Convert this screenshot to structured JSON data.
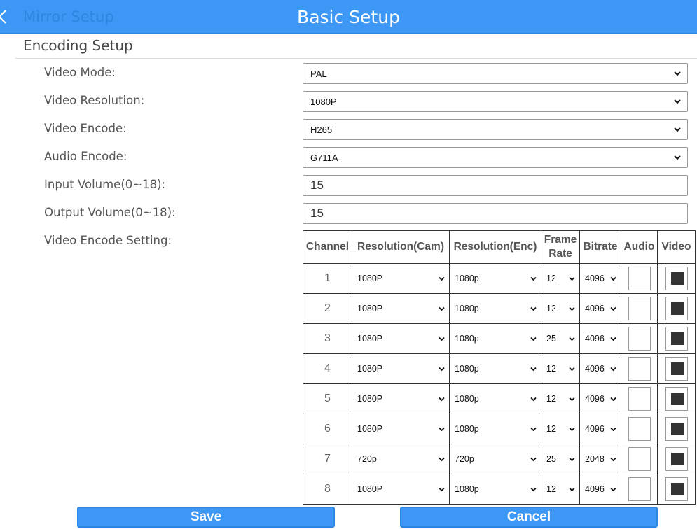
{
  "header": {
    "back_label": "Mirror Setup",
    "title": "Basic Setup"
  },
  "section": {
    "title": "Encoding Setup"
  },
  "form": {
    "video_mode": {
      "label": "Video Mode:",
      "value": "PAL"
    },
    "video_resolution": {
      "label": "Video Resolution:",
      "value": "1080P"
    },
    "video_encode": {
      "label": "Video Encode:",
      "value": "H265"
    },
    "audio_encode": {
      "label": "Audio Encode:",
      "value": "G711A"
    },
    "input_volume": {
      "label": "Input Volume(0~18):",
      "value": "15"
    },
    "output_volume": {
      "label": "Output Volume(0~18):",
      "value": "15"
    },
    "encode_setting_label": "Video Encode Setting:"
  },
  "table": {
    "headers": {
      "channel": "Channel",
      "res_cam": "Resolution(Cam)",
      "res_enc": "Resolution(Enc)",
      "frame": "Frame",
      "rate": "Rate",
      "bitrate": "Bitrate",
      "audio": "Audio",
      "video": "Video"
    },
    "rows": [
      {
        "channel": "1",
        "res_cam": "1080P",
        "res_enc": "1080p",
        "frame_rate": "12",
        "bitrate": "4096",
        "audio": false,
        "video": true
      },
      {
        "channel": "2",
        "res_cam": "1080P",
        "res_enc": "1080p",
        "frame_rate": "12",
        "bitrate": "4096",
        "audio": false,
        "video": true
      },
      {
        "channel": "3",
        "res_cam": "1080P",
        "res_enc": "1080p",
        "frame_rate": "25",
        "bitrate": "4096",
        "audio": false,
        "video": true
      },
      {
        "channel": "4",
        "res_cam": "1080P",
        "res_enc": "1080p",
        "frame_rate": "12",
        "bitrate": "4096",
        "audio": false,
        "video": true
      },
      {
        "channel": "5",
        "res_cam": "1080P",
        "res_enc": "1080p",
        "frame_rate": "12",
        "bitrate": "4096",
        "audio": false,
        "video": true
      },
      {
        "channel": "6",
        "res_cam": "1080P",
        "res_enc": "1080p",
        "frame_rate": "12",
        "bitrate": "4096",
        "audio": false,
        "video": true
      },
      {
        "channel": "7",
        "res_cam": "720p",
        "res_enc": "720p",
        "frame_rate": "25",
        "bitrate": "2048",
        "audio": false,
        "video": true
      },
      {
        "channel": "8",
        "res_cam": "1080P",
        "res_enc": "1080p",
        "frame_rate": "12",
        "bitrate": "4096",
        "audio": false,
        "video": true
      }
    ]
  },
  "buttons": {
    "save": "Save",
    "cancel": "Cancel"
  },
  "colors": {
    "accent": "#3d97f5",
    "header_text": "#ffffff"
  },
  "icons": {
    "back": "chevron-left-icon",
    "dropdown": "chevron-down-icon"
  }
}
